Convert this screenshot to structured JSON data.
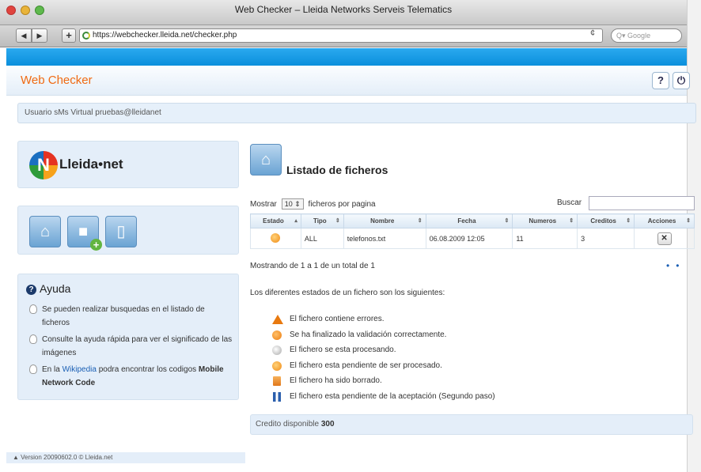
{
  "window": {
    "title": "Web Checker – Lleida Networks Serveis Telematics",
    "url": "https://webchecker.lleida.net/checker.php",
    "search_placeholder": "Google",
    "search_prefix": "Q▾",
    "back_glyph": "◀",
    "forward_glyph": "▶",
    "add_glyph": "+",
    "reload_glyph": "¢"
  },
  "header": {
    "app_title": "Web Checker",
    "help_glyph": "?",
    "power_glyph": "⏻",
    "help_icon": "help-icon",
    "power_icon": "power-icon"
  },
  "user_bar": {
    "text": "Usuario sMs Virtual pruebas@lleidanet"
  },
  "sidebar": {
    "logo_text": "Lleida•net",
    "logo_letter": "N",
    "tiles": [
      {
        "icon": "home-icon",
        "glyph": "⌂"
      },
      {
        "icon": "add-file-icon",
        "glyph": "■",
        "badge": "+"
      },
      {
        "icon": "file-icon",
        "glyph": "▯"
      }
    ],
    "help": {
      "title": "Ayuda",
      "title_icon": "?",
      "items": [
        {
          "text": "Se pueden realizar busquedas en el listado de ficheros"
        },
        {
          "text": "Consulte la ayuda rápida para ver el significado de las imágenes"
        },
        {
          "prefix": "En la ",
          "link": "Wikipedia",
          "middle": " podra encontrar los codigos ",
          "strong": "Mobile Network Code"
        }
      ]
    },
    "version": "▲  Version 20090602.0 © Lleida.net"
  },
  "main": {
    "title": "Listado de ficheros",
    "home_glyph": "⌂",
    "show_label": "Mostrar",
    "page_size": "10",
    "page_size_arrow": "⇕",
    "per_page_label": "ficheros por pagina",
    "search_label": "Buscar",
    "search_value": "",
    "table": {
      "sort_glyph_active": "▴",
      "sort_glyph": "⇕",
      "columns": [
        "Estado",
        "Tipo",
        "Nombre",
        "Fecha",
        "Numeros",
        "Creditos",
        "Acciones"
      ],
      "rows": [
        {
          "estado_icon": "pending-status-icon",
          "tipo": "ALL",
          "nombre": "telefonos.txt",
          "fecha": "06.08.2009 12:05",
          "numeros": "11",
          "creditos": "3",
          "accion": "✕"
        }
      ]
    },
    "info": "Mostrando de 1 a 1 de un total de 1",
    "pager": "••",
    "estados_intro": "Los diferentes estados de un fichero son los siguientes:",
    "legend": [
      {
        "icon": "warning-icon",
        "text": "El fichero contiene errores."
      },
      {
        "icon": "ok-icon",
        "text": "Se ha finalizado la validación correctamente."
      },
      {
        "icon": "processing-icon",
        "text": "El fichero se esta procesando."
      },
      {
        "icon": "pending-icon",
        "text": "El fichero esta pendiente de ser procesado."
      },
      {
        "icon": "deleted-icon",
        "text": "El fichero ha sido borrado."
      },
      {
        "icon": "pause-icon",
        "text": "El fichero esta pendiente de la aceptación (Segundo paso)"
      }
    ],
    "credit_label": "Credito disponible",
    "credit_value": "300"
  }
}
